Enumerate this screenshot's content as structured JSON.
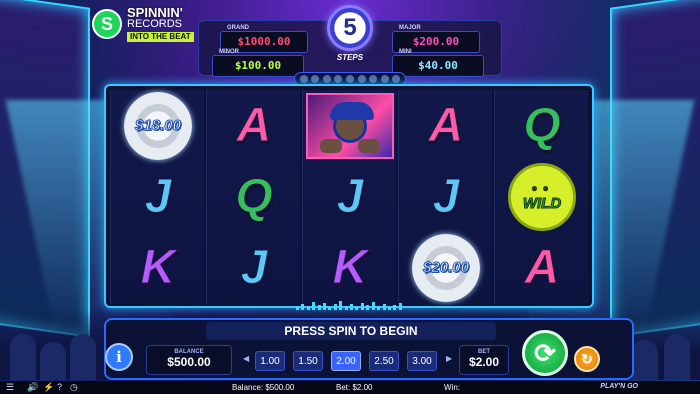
{
  "logo": {
    "mark": "S",
    "line1": "SPINNIN'",
    "line2": "RECORDS",
    "tag": "INTO THE BEAT"
  },
  "jackpots": {
    "grand": {
      "label": "GRAND",
      "value": "$1000.00"
    },
    "major": {
      "label": "MAJOR",
      "value": "$200.00"
    },
    "minor": {
      "label": "MINOR",
      "value": "$100.00"
    },
    "mini": {
      "label": "MINI",
      "value": "$40.00"
    }
  },
  "steps": {
    "count": "5",
    "label": "STEPS"
  },
  "reels": [
    [
      {
        "kind": "coin",
        "text": "$18.00"
      },
      {
        "kind": "letter",
        "text": "J"
      },
      {
        "kind": "letter",
        "text": "K"
      }
    ],
    [
      {
        "kind": "letter",
        "text": "A"
      },
      {
        "kind": "letter",
        "text": "Q"
      },
      {
        "kind": "letter",
        "text": "J"
      }
    ],
    [
      {
        "kind": "character",
        "text": ""
      },
      {
        "kind": "letter",
        "text": "J"
      },
      {
        "kind": "letter",
        "text": "K"
      }
    ],
    [
      {
        "kind": "letter",
        "text": "A"
      },
      {
        "kind": "letter",
        "text": "J"
      },
      {
        "kind": "coin",
        "text": "$20.00"
      }
    ],
    [
      {
        "kind": "letter",
        "text": "Q"
      },
      {
        "kind": "wild",
        "text": "WILD"
      },
      {
        "kind": "letter",
        "text": "A"
      }
    ]
  ],
  "panel": {
    "message": "PRESS SPIN TO BEGIN",
    "info": "i",
    "balance_label": "BALANCE",
    "balance_value": "$500.00",
    "bet_label": "BET",
    "bet_value": "$2.00",
    "bet_options": [
      "1.00",
      "1.50",
      "2.00",
      "2.50",
      "3.00"
    ],
    "selected_bet": "2.00",
    "spin_icon": "refresh-icon",
    "autoplay_icon": "autoplay-icon"
  },
  "status": {
    "balance": "Balance: $500.00",
    "bet": "Bet: $2.00",
    "win": "Win:",
    "brand": "PLAY'N GO"
  }
}
